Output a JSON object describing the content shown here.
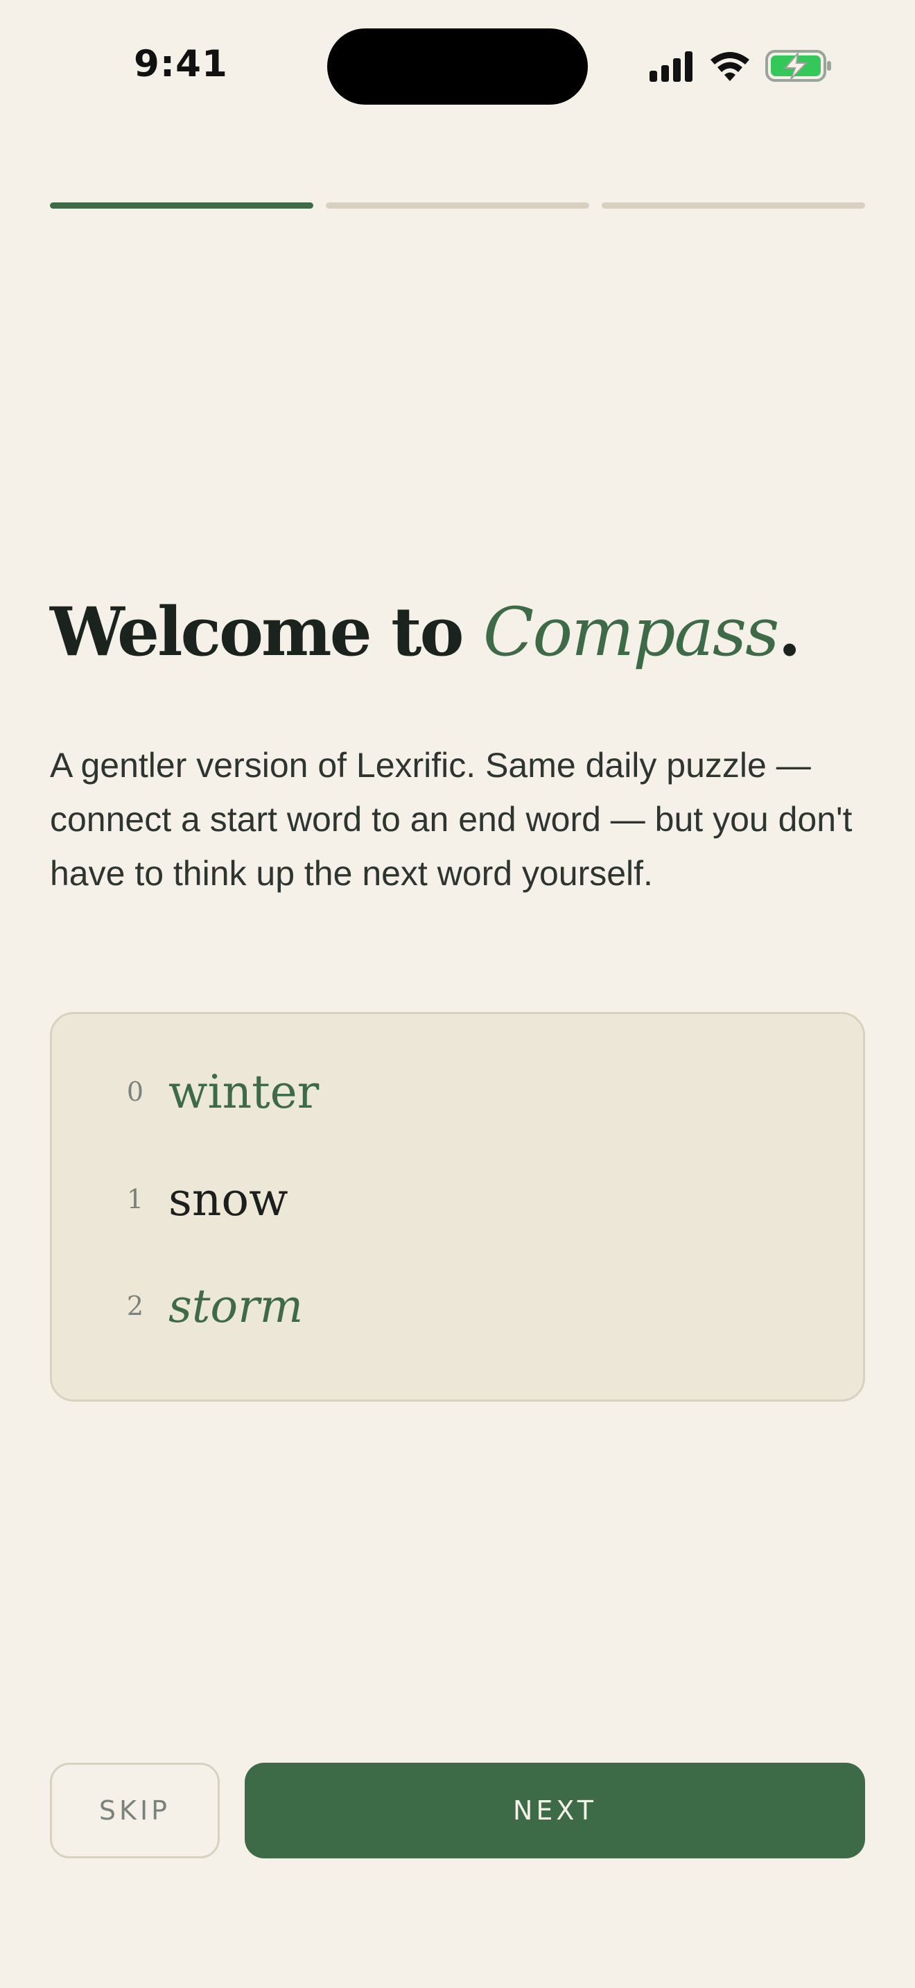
{
  "status_bar": {
    "time": "9:41",
    "icons": [
      "cellular-signal-icon",
      "wifi-icon",
      "battery-charging-icon"
    ],
    "battery_color": "#34c759"
  },
  "progress": {
    "steps_total": 3,
    "current_step": 1
  },
  "headline": {
    "prefix": "Welcome to",
    "brand": "Compass",
    "suffix": "."
  },
  "intro": {
    "text": "A gentler version of Lexrific. Same daily puzzle — connect a start word to an end word — but you don't have to think up the next word yourself."
  },
  "example_chain": {
    "items": [
      {
        "index": "0",
        "word": "winter"
      },
      {
        "index": "1",
        "word": "snow"
      },
      {
        "index": "2",
        "word": "storm"
      }
    ]
  },
  "actions": {
    "skip_label": "SKIP",
    "next_label": "NEXT"
  },
  "colors": {
    "background": "#f5f0e8",
    "accent": "#3d6b48",
    "card": "#ede7d8",
    "inactive_progress": "#d8d0c0"
  }
}
